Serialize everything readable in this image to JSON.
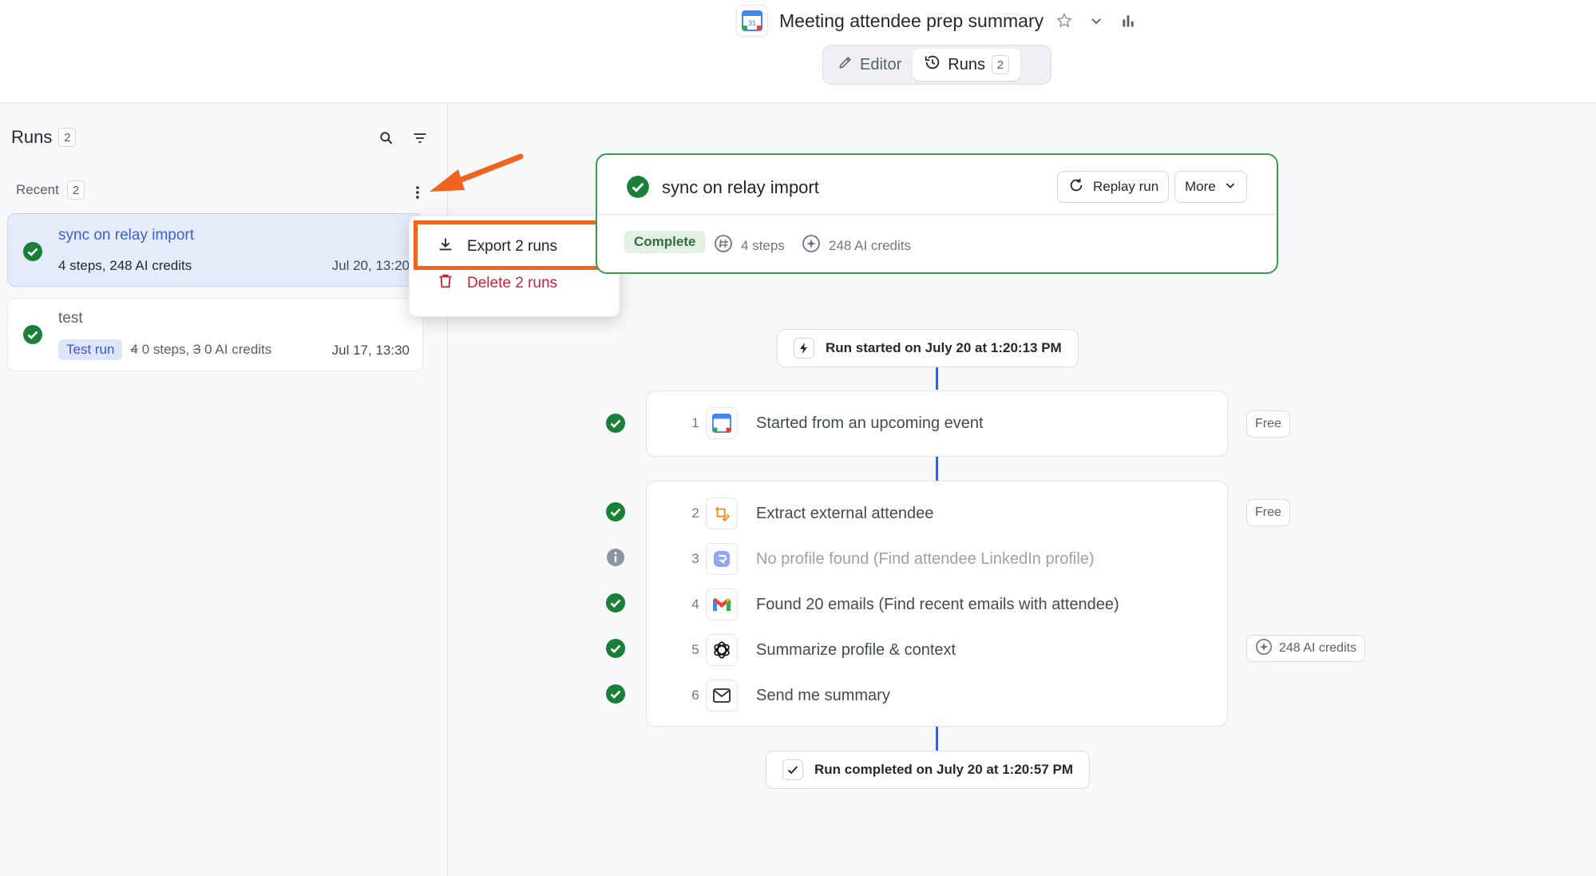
{
  "app": {
    "title": "Meeting attendee prep summary",
    "calendar_day": "31"
  },
  "tabs": [
    {
      "label": "Editor",
      "icon": "pencil-icon"
    },
    {
      "label": "Runs",
      "icon": "history-icon",
      "count": "2"
    }
  ],
  "sidebar": {
    "title": "Runs",
    "count": "2",
    "recent_label": "Recent",
    "recent_count": "2",
    "runs": [
      {
        "name": "sync on relay import",
        "meta": "4 steps, 248 AI credits",
        "date": "Jul 20, 13:20"
      },
      {
        "name": "test",
        "badge": "Test run",
        "meta_steps_struck": "4",
        "meta_steps": "0 steps,",
        "meta_credits_struck": "3",
        "meta_credits": "0 AI credits",
        "date": "Jul 17, 13:30"
      }
    ]
  },
  "menu": {
    "export_label": "Export 2 runs",
    "delete_label": "Delete 2 runs"
  },
  "run": {
    "title": "sync on relay import",
    "replay_label": "Replay run",
    "more_label": "More",
    "status": "Complete",
    "steps_stat": "4 steps",
    "credits_stat": "248 AI credits",
    "started": "Run started on July 20 at 1:20:13 PM",
    "completed": "Run completed on July 20 at 1:20:57 PM",
    "steps": [
      {
        "num": "1",
        "label": "Started from an upcoming event",
        "icon": "google-calendar-icon",
        "status": "success",
        "cost": "Free"
      },
      {
        "num": "2",
        "label": "Extract external attendee",
        "icon": "transform-icon",
        "status": "success",
        "cost": "Free"
      },
      {
        "num": "3",
        "label": "No profile found (Find attendee LinkedIn profile)",
        "icon": "relay-icon",
        "status": "info",
        "cost": ""
      },
      {
        "num": "4",
        "label": "Found 20 emails (Find recent emails with attendee)",
        "icon": "gmail-icon",
        "status": "success",
        "cost": ""
      },
      {
        "num": "5",
        "label": "Summarize profile & context",
        "icon": "openai-icon",
        "status": "success",
        "cost": "248 AI credits"
      },
      {
        "num": "6",
        "label": "Send me summary",
        "icon": "mail-icon",
        "status": "success",
        "cost": ""
      }
    ]
  },
  "colors": {
    "success": "#1a7f37",
    "accent": "#3d5fd0",
    "annotation": "#f0641e",
    "danger": "#c2263b"
  }
}
